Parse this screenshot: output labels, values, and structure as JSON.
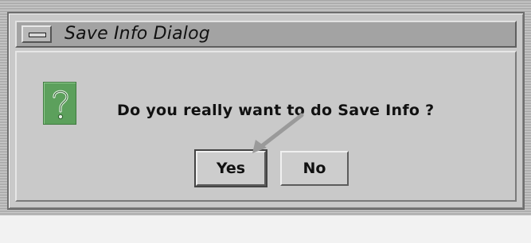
{
  "window": {
    "title": "Save Info Dialog",
    "menu_icon": "window-menu-icon"
  },
  "dialog": {
    "icon": "question-icon",
    "icon_glyph": "?",
    "message": "Do you really want to do Save Info ?",
    "buttons": {
      "yes_label": "Yes",
      "no_label": "No"
    },
    "default_button": "Yes"
  },
  "colors": {
    "icon_background": "#5ca05c",
    "window_background": "#c9c9c9",
    "titlebar": "#a3a3a3"
  }
}
